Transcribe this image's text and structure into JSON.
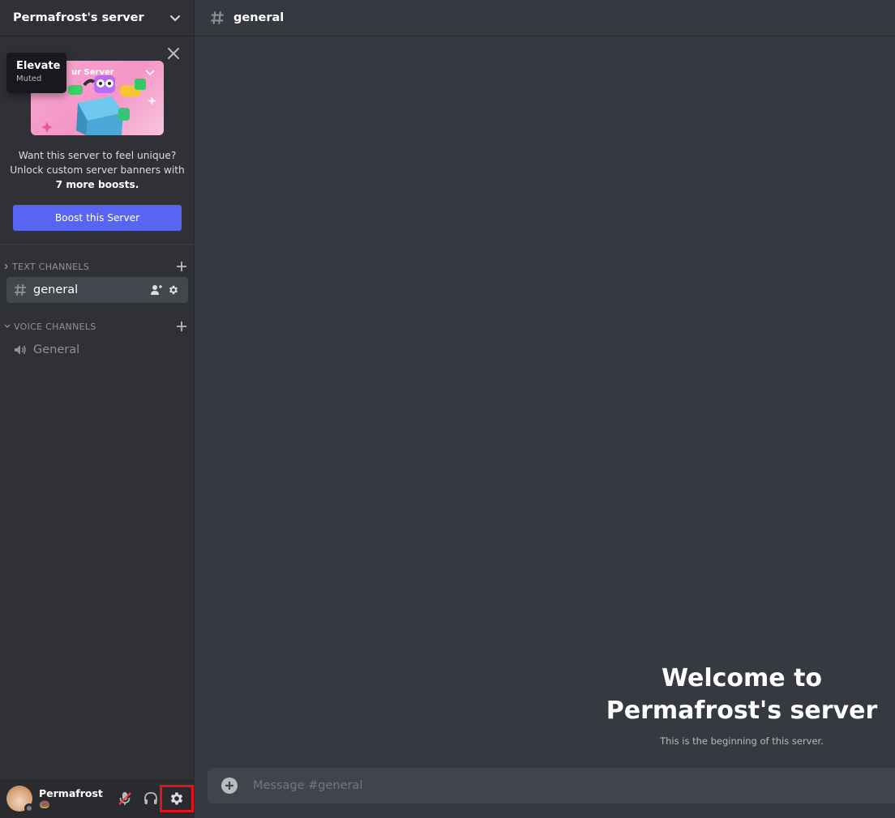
{
  "server": {
    "name": "Permafrost's server"
  },
  "tooltip": {
    "title": "Elevate",
    "subtitle": "Muted"
  },
  "boost": {
    "banner_label": "ur Server",
    "text_line1": "Want this server to feel unique?",
    "text_line2": "Unlock custom server banners with",
    "text_bold": "7 more boosts.",
    "button_label": "Boost this Server"
  },
  "categories": {
    "text": {
      "label": "TEXT CHANNELS"
    },
    "voice": {
      "label": "VOICE CHANNELS"
    }
  },
  "channels": {
    "text": [
      {
        "name": "general"
      }
    ],
    "voice": [
      {
        "name": "General"
      }
    ]
  },
  "user": {
    "name": "Permafrost",
    "status_emoji": "🍩"
  },
  "chat": {
    "channel_name": "general",
    "welcome_title_line1": "Welcome to",
    "welcome_title_line2": "Permafrost's server",
    "welcome_subtitle": "This is the beginning of this server."
  },
  "composer": {
    "placeholder": "Message #general"
  },
  "colors": {
    "accent": "#5865f2",
    "background": "#36393f",
    "sidebar": "#2f3136",
    "user_panel": "#292b2f",
    "highlight": "#e3131b"
  }
}
